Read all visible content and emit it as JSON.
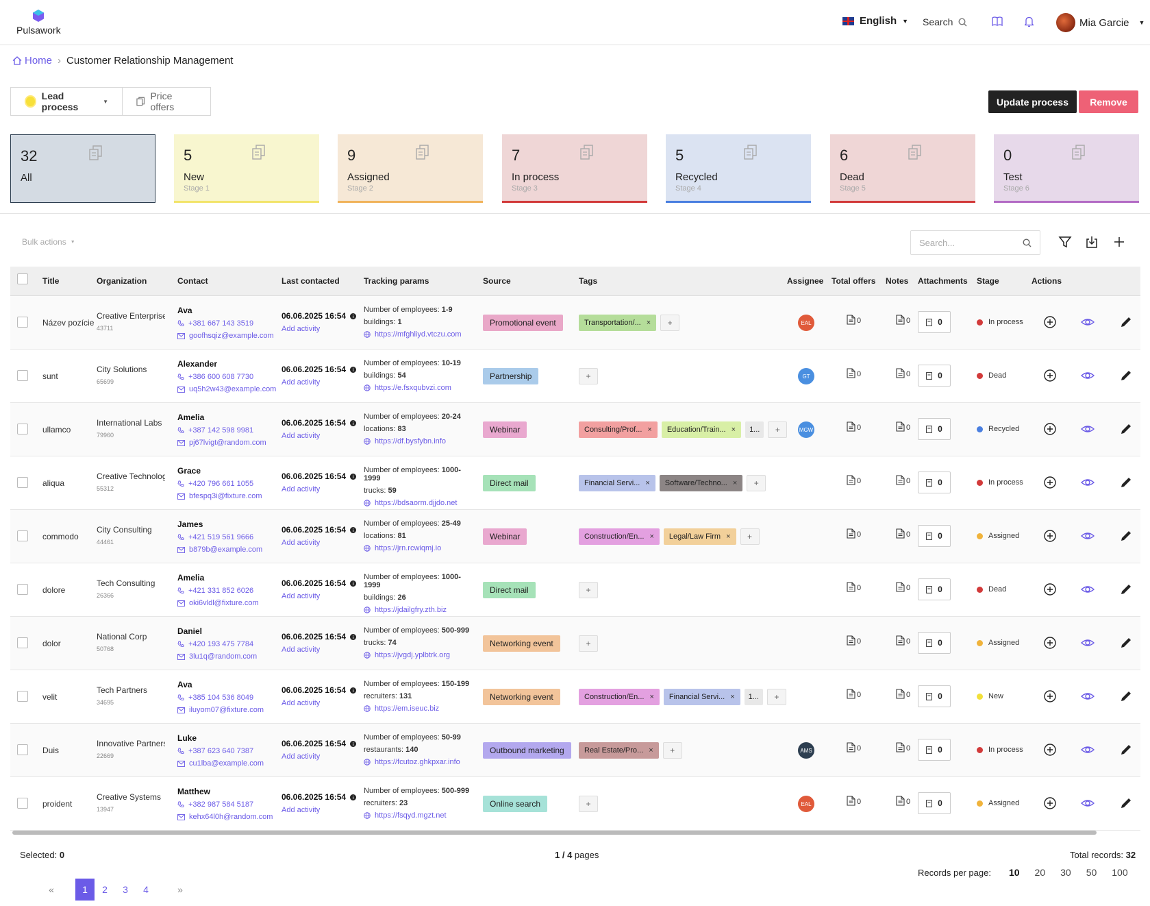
{
  "app": {
    "name": "Pulsawork"
  },
  "topbar": {
    "language": "English",
    "search_label": "Search",
    "user_name": "Mia Garcie"
  },
  "breadcrumb": {
    "home": "Home",
    "current": "Customer Relationship Management"
  },
  "process": {
    "lead": "Lead process",
    "price": "Price offers",
    "update": "Update process",
    "remove": "Remove"
  },
  "stages": [
    {
      "count": "32",
      "name": "All",
      "sub": "",
      "bg": "#d4dbe3",
      "border": "#2d3e50"
    },
    {
      "count": "5",
      "name": "New",
      "sub": "Stage 1",
      "bg": "#f8f6cf",
      "border": "#f2e46b"
    },
    {
      "count": "9",
      "name": "Assigned",
      "sub": "Stage 2",
      "bg": "#f6e8d6",
      "border": "#f0b35b"
    },
    {
      "count": "7",
      "name": "In process",
      "sub": "Stage 3",
      "bg": "#efd6d6",
      "border": "#d23a3a"
    },
    {
      "count": "5",
      "name": "Recycled",
      "sub": "Stage 4",
      "bg": "#dbe3f2",
      "border": "#4a7fe0"
    },
    {
      "count": "6",
      "name": "Dead",
      "sub": "Stage 5",
      "bg": "#efd6d6",
      "border": "#d23a3a"
    },
    {
      "count": "0",
      "name": "Test",
      "sub": "Stage 6",
      "bg": "#e7d9ea",
      "border": "#b36bc5"
    }
  ],
  "toolbar": {
    "bulk": "Bulk actions",
    "search_placeholder": "Search..."
  },
  "columns": [
    "Title",
    "Organization",
    "Contact",
    "Last contacted",
    "Tracking params",
    "Source",
    "Tags",
    "Assignee",
    "Total offers",
    "Notes",
    "Attachments",
    "Stage",
    "Actions"
  ],
  "rows": [
    {
      "title": "Název pozície",
      "org": "Creative Enterprises",
      "org_id": "43711",
      "name": "Ava",
      "phone": "+381 667 143 3519",
      "email": "goofhsqiz@example.com",
      "date": "06.06.2025 16:54",
      "add": "Add activity",
      "p1k": "Number of employees: ",
      "p1v": "1-9",
      "p2k": "buildings: ",
      "p2v": "1",
      "url": "https://mfghliyd.vtczu.com",
      "source": "Promotional event",
      "src_bg": "#e9a8c8",
      "tags": [
        {
          "t": "Transportation/...",
          "bg": "#b5dd9a"
        }
      ],
      "more": "",
      "assignee": "EAL",
      "asg_bg": "#e05a3a",
      "offers": "0",
      "notes": "0",
      "att": "0",
      "stage": "In process",
      "stage_c": "#d23a3a"
    },
    {
      "title": "sunt",
      "org": "City Solutions",
      "org_id": "65699",
      "name": "Alexander",
      "phone": "+386 600 608 7730",
      "email": "uq5h2w43@example.com",
      "date": "06.06.2025 16:54",
      "add": "Add activity",
      "p1k": "Number of employees: ",
      "p1v": "10-19",
      "p2k": "buildings: ",
      "p2v": "54",
      "url": "https://e.fsxqubvzi.com",
      "source": "Partnership",
      "src_bg": "#aacbea",
      "tags": [],
      "more": "",
      "assignee": "GT",
      "asg_bg": "#4a8fe0",
      "offers": "0",
      "notes": "0",
      "att": "0",
      "stage": "Dead",
      "stage_c": "#d23a3a"
    },
    {
      "title": "ullamco",
      "org": "International Labs",
      "org_id": "79960",
      "name": "Amelia",
      "phone": "+387 142 598 9981",
      "email": "pj67lvigt@random.com",
      "date": "06.06.2025 16:54",
      "add": "Add activity",
      "p1k": "Number of employees: ",
      "p1v": "20-24",
      "p2k": "locations: ",
      "p2v": "83",
      "url": "https://df.bysfybn.info",
      "source": "Webinar",
      "src_bg": "#e9a8cf",
      "tags": [
        {
          "t": "Consulting/Prof...",
          "bg": "#f2a0a0"
        },
        {
          "t": "Education/Train...",
          "bg": "#d8efa6"
        }
      ],
      "more": "1...",
      "assignee": "MGW",
      "asg_bg": "#4a8fe0",
      "offers": "0",
      "notes": "0",
      "att": "0",
      "stage": "Recycled",
      "stage_c": "#4a7fe0"
    },
    {
      "title": "aliqua",
      "org": "Creative Technologie...",
      "org_id": "55312",
      "name": "Grace",
      "phone": "+420 796 661 1055",
      "email": "bfespq3i@fixture.com",
      "date": "06.06.2025 16:54",
      "add": "Add activity",
      "p1k": "Number of employees: ",
      "p1v": "1000-1999",
      "p2k": "trucks: ",
      "p2v": "59",
      "url": "https://bdsaorm.djjdo.net",
      "source": "Direct mail",
      "src_bg": "#a6e2b8",
      "tags": [
        {
          "t": "Financial Servi...",
          "bg": "#b8c3ea"
        },
        {
          "t": "Software/Techno...",
          "bg": "#8c8585"
        }
      ],
      "more": "",
      "assignee": "",
      "asg_bg": "",
      "offers": "0",
      "notes": "0",
      "att": "0",
      "stage": "In process",
      "stage_c": "#d23a3a"
    },
    {
      "title": "commodo",
      "org": "City Consulting",
      "org_id": "44461",
      "name": "James",
      "phone": "+421 519 561 9666",
      "email": "b879b@example.com",
      "date": "06.06.2025 16:54",
      "add": "Add activity",
      "p1k": "Number of employees: ",
      "p1v": "25-49",
      "p2k": "locations: ",
      "p2v": "81",
      "url": "https://jrn.rcwiqmj.io",
      "source": "Webinar",
      "src_bg": "#e9a8cf",
      "tags": [
        {
          "t": "Construction/En...",
          "bg": "#e3a0e0"
        },
        {
          "t": "Legal/Law Firm",
          "bg": "#f2d09a"
        }
      ],
      "more": "",
      "assignee": "",
      "asg_bg": "",
      "offers": "0",
      "notes": "0",
      "att": "0",
      "stage": "Assigned",
      "stage_c": "#f0b33b"
    },
    {
      "title": "dolore",
      "org": "Tech Consulting",
      "org_id": "26366",
      "name": "Amelia",
      "phone": "+421 331 852 6026",
      "email": "oki6vldl@fixture.com",
      "date": "06.06.2025 16:54",
      "add": "Add activity",
      "p1k": "Number of employees: ",
      "p1v": "1000-1999",
      "p2k": "buildings: ",
      "p2v": "26",
      "url": "https://jdailgfry.zth.biz",
      "source": "Direct mail",
      "src_bg": "#a6e2b8",
      "tags": [],
      "more": "",
      "assignee": "",
      "asg_bg": "",
      "offers": "0",
      "notes": "0",
      "att": "0",
      "stage": "Dead",
      "stage_c": "#d23a3a"
    },
    {
      "title": "dolor",
      "org": "National Corp",
      "org_id": "50768",
      "name": "Daniel",
      "phone": "+420 193 475 7784",
      "email": "3lu1q@random.com",
      "date": "06.06.2025 16:54",
      "add": "Add activity",
      "p1k": "Number of employees: ",
      "p1v": "500-999",
      "p2k": "trucks: ",
      "p2v": "74",
      "url": "https://jvgdj.yplbtrk.org",
      "source": "Networking event",
      "src_bg": "#f2c49a",
      "tags": [],
      "more": "",
      "assignee": "",
      "asg_bg": "",
      "offers": "0",
      "notes": "0",
      "att": "0",
      "stage": "Assigned",
      "stage_c": "#f0b33b"
    },
    {
      "title": "velit",
      "org": "Tech Partners",
      "org_id": "34695",
      "name": "Ava",
      "phone": "+385 104 536 8049",
      "email": "iluyom07@fixture.com",
      "date": "06.06.2025 16:54",
      "add": "Add activity",
      "p1k": "Number of employees: ",
      "p1v": "150-199",
      "p2k": "recruiters: ",
      "p2v": "131",
      "url": "https://em.iseuc.biz",
      "source": "Networking event",
      "src_bg": "#f2c49a",
      "tags": [
        {
          "t": "Construction/En...",
          "bg": "#e3a0e0"
        },
        {
          "t": "Financial Servi...",
          "bg": "#b8c3ea"
        }
      ],
      "more": "1...",
      "assignee": "",
      "asg_bg": "",
      "offers": "0",
      "notes": "0",
      "att": "0",
      "stage": "New",
      "stage_c": "#f2e03a"
    },
    {
      "title": "Duis",
      "org": "Innovative Partners",
      "org_id": "22669",
      "name": "Luke",
      "phone": "+387 623 640 7387",
      "email": "cu1lba@example.com",
      "date": "06.06.2025 16:54",
      "add": "Add activity",
      "p1k": "Number of employees: ",
      "p1v": "50-99",
      "p2k": "restaurants: ",
      "p2v": "140",
      "url": "https://fcutoz.ghkpxar.info",
      "source": "Outbound marketing",
      "src_bg": "#b3a8ee",
      "tags": [
        {
          "t": "Real Estate/Pro...",
          "bg": "#c79a9a"
        }
      ],
      "more": "",
      "assignee": "AMS",
      "asg_bg": "#2d3e50",
      "offers": "0",
      "notes": "0",
      "att": "0",
      "stage": "In process",
      "stage_c": "#d23a3a"
    },
    {
      "title": "proident",
      "org": "Creative Systems",
      "org_id": "13947",
      "name": "Matthew",
      "phone": "+382 987 584 5187",
      "email": "kehx64l0h@random.com",
      "date": "06.06.2025 16:54",
      "add": "Add activity",
      "p1k": "Number of employees: ",
      "p1v": "500-999",
      "p2k": "recruiters: ",
      "p2v": "23",
      "url": "https://fsqyd.mgzt.net",
      "source": "Online search",
      "src_bg": "#a6e2d8",
      "tags": [],
      "more": "",
      "assignee": "EAL",
      "asg_bg": "#e05a3a",
      "offers": "0",
      "notes": "0",
      "att": "0",
      "stage": "Assigned",
      "stage_c": "#f0b33b"
    }
  ],
  "footer": {
    "selected_label": "Selected: ",
    "selected": "0",
    "page_info": "1 / 4",
    "pages_word": " pages",
    "total_label": "Total records: ",
    "total": "32",
    "rpp_label": "Records per page:",
    "rpp": [
      "10",
      "20",
      "30",
      "50",
      "100"
    ],
    "rpp_selected": "10",
    "pages": [
      "1",
      "2",
      "3",
      "4"
    ],
    "current_page": "1"
  }
}
